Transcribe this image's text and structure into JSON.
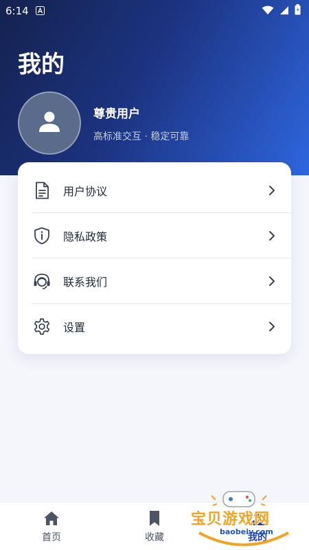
{
  "status_bar": {
    "time": "6:14",
    "icons": [
      "notification-a-icon",
      "wifi-icon",
      "battery-icon"
    ]
  },
  "page": {
    "title": "我的"
  },
  "profile": {
    "name": "尊贵用户",
    "subtitle": "高标准交互 · 稳定可靠"
  },
  "menu": {
    "items": [
      {
        "label": "用户协议",
        "icon": "document-icon"
      },
      {
        "label": "隐私政策",
        "icon": "shield-icon"
      },
      {
        "label": "联系我们",
        "icon": "headset-icon"
      },
      {
        "label": "设置",
        "icon": "gear-icon"
      }
    ]
  },
  "tab_bar": {
    "items": [
      {
        "label": "首页",
        "icon": "home-icon"
      },
      {
        "label": "收藏",
        "icon": "bookmark-icon"
      },
      {
        "label": "我的",
        "icon": "user-icon",
        "active": true
      }
    ]
  },
  "watermark": {
    "text": "宝贝游戏网",
    "url": "baobeiy.com"
  },
  "colors": {
    "header_gradient_start": "#14224f",
    "header_gradient_end": "#2f66df",
    "accent": "#1f3fae",
    "background": "#f4f6fb"
  }
}
